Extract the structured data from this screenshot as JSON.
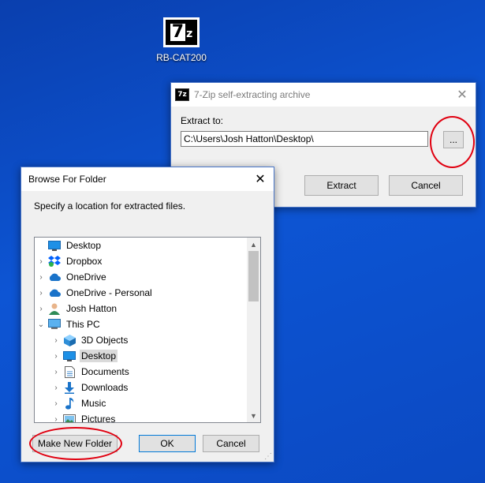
{
  "desktop": {
    "icon_label": "RB-CAT200",
    "icon_glyph_big": "7",
    "icon_glyph_small": "z"
  },
  "zip_window": {
    "icon_glyph": "7z",
    "title": "7-Zip self-extracting archive",
    "close_glyph": "✕",
    "extract_to_label": "Extract to:",
    "path_value": "C:\\Users\\Josh Hatton\\Desktop\\",
    "browse_button": "...",
    "extract_button": "Extract",
    "cancel_button": "Cancel"
  },
  "browse_window": {
    "title": "Browse For Folder",
    "close_glyph": "✕",
    "instruction": "Specify a location for extracted files.",
    "tree": [
      {
        "label": "Desktop",
        "icon": "desktop-icon",
        "chev": "",
        "level": 0
      },
      {
        "label": "Dropbox",
        "icon": "dropbox-icon",
        "chev": "›",
        "level": 0
      },
      {
        "label": "OneDrive",
        "icon": "cloud-icon",
        "chev": "›",
        "level": 0
      },
      {
        "label": "OneDrive - Personal",
        "icon": "cloud-icon",
        "chev": "›",
        "level": 0
      },
      {
        "label": "Josh Hatton",
        "icon": "user-icon",
        "chev": "›",
        "level": 0
      },
      {
        "label": "This PC",
        "icon": "computer-icon",
        "chev": "⌄",
        "level": 0
      },
      {
        "label": "3D Objects",
        "icon": "cube-icon",
        "chev": "›",
        "level": 1
      },
      {
        "label": "Desktop",
        "icon": "desktop-icon",
        "chev": "›",
        "level": 1,
        "selected": true
      },
      {
        "label": "Documents",
        "icon": "document-icon",
        "chev": "›",
        "level": 1
      },
      {
        "label": "Downloads",
        "icon": "download-icon",
        "chev": "›",
        "level": 1
      },
      {
        "label": "Music",
        "icon": "music-icon",
        "chev": "›",
        "level": 1
      },
      {
        "label": "Pictures",
        "icon": "picture-icon",
        "chev": "›",
        "level": 1
      }
    ],
    "make_folder_button": "Make New Folder",
    "ok_button": "OK",
    "cancel_button": "Cancel"
  },
  "colors": {
    "desktop_bg": "#0d55d4",
    "annotation": "#e00010",
    "onedrive": "#1a73c9"
  }
}
